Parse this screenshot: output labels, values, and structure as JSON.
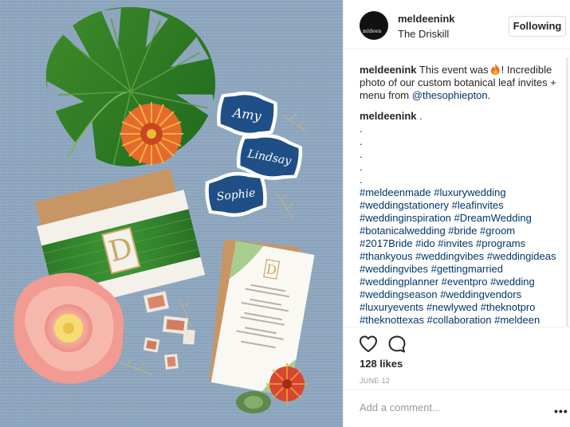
{
  "post": {
    "username": "meldeenink",
    "location": "The Driskill",
    "follow_label": "Following",
    "avatar_text": "mldeen"
  },
  "caption": {
    "username": "meldeenink",
    "text_before_emoji": "This event was",
    "emoji": "fire-emoji",
    "text_after_emoji": "! Incredible photo of our custom botanical leaf invites + menu from",
    "mention": "@thesophiepton",
    "text_end": "."
  },
  "comment": {
    "username": "meldeenink",
    "text": ".",
    "dots": [
      ".",
      ".",
      ".",
      ".",
      "."
    ],
    "hashtags": "#meldeenmade #luxurywedding #weddingstationery #leafinvites #weddinginspiration #DreamWedding #botanicalwedding #bride #groom #2017Bride #ido #invites #programs #thankyous #weddingvibes #weddingideas #weddingvibes #gettingmarried #weddingplanner #eventpro #wedding #weddingseason #weddingvendors #luxuryevents #newlywed #theknotpro #theknottexas #collaboration #meldeen"
  },
  "stats": {
    "likes": "128 likes",
    "date": "JUNE 12"
  },
  "comment_input": {
    "placeholder": "Add a comment..."
  },
  "more_label": "•••",
  "photo": {
    "place_cards": [
      "Amy",
      "Lindsay",
      "Sophie"
    ],
    "invite_letter": "D",
    "menu_letter": "D",
    "icons": [
      "heart-icon",
      "comment-icon"
    ]
  }
}
